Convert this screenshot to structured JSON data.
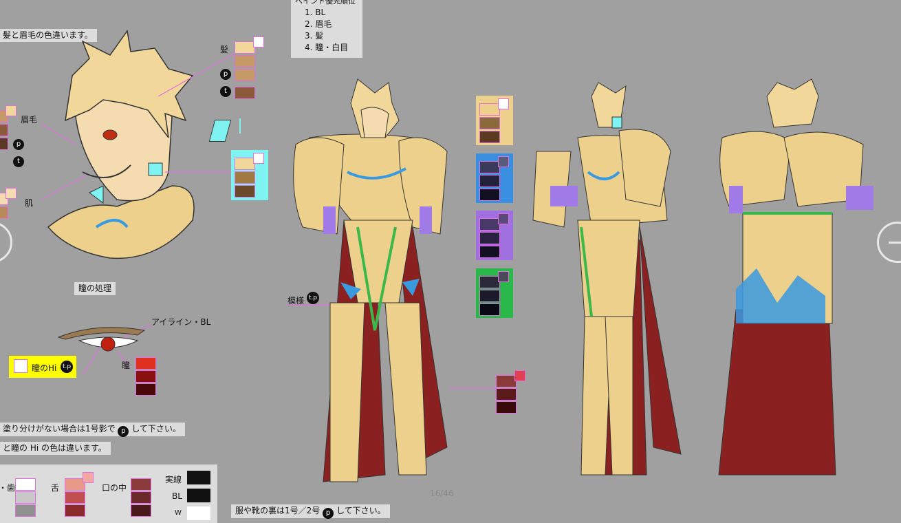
{
  "paint_priority": {
    "title_partial": "ペイント優先順位",
    "items": [
      "1. BL",
      "2. 眉毛",
      "3. 髪",
      "4. 瞳・白目"
    ]
  },
  "notes": {
    "hair_brow": "髪と眉毛の色違います。",
    "no_split": "塗り分けがない場合は1号影で",
    "no_split_suffix": "して下さい。",
    "eye_hi": "と瞳の Hi の色は違います。",
    "clothes_back": "服や靴の裏は1号／2号",
    "clothes_back_suffix": "して下さい。"
  },
  "labels": {
    "hair": "髪",
    "eyebrow": "眉毛",
    "skin": "肌",
    "eye_section": "瞳の処理",
    "eyeline": "アイライン・BL",
    "pupil": "瞳",
    "pupil_hi": "瞳のHi",
    "pattern": "模様",
    "tongue": "舌",
    "mouth_inside": "口の中",
    "teeth": "・歯",
    "jissen": "実線",
    "bl": "BL",
    "w": "W",
    "page": "16/46"
  },
  "badges": {
    "p": "p",
    "t": "t",
    "tp": "t.p"
  },
  "colors": {
    "bg": "#a0a0a0",
    "hair_base": "#f2d79a",
    "hair_p": "#c59a66",
    "hair_t": "#8a5a3a",
    "skin_base": "#f4dcb0",
    "skin_p": "#b88a5a",
    "skin_t": "#7a5030",
    "cyan_panel": "#7ff2f2",
    "blue_panel": "#3a8fe0",
    "purple_panel": "#a070e0",
    "green_panel": "#2bb84a",
    "armor": "#ecd08c",
    "cloak": "#8a2020",
    "accent_blue": "#3a9ae0",
    "undersuit": "#a07ae6",
    "belt": "#3ab84a",
    "pupil_red": "#e03020",
    "yellow_box": "#ffff00",
    "line_pink": "#e070e0"
  }
}
